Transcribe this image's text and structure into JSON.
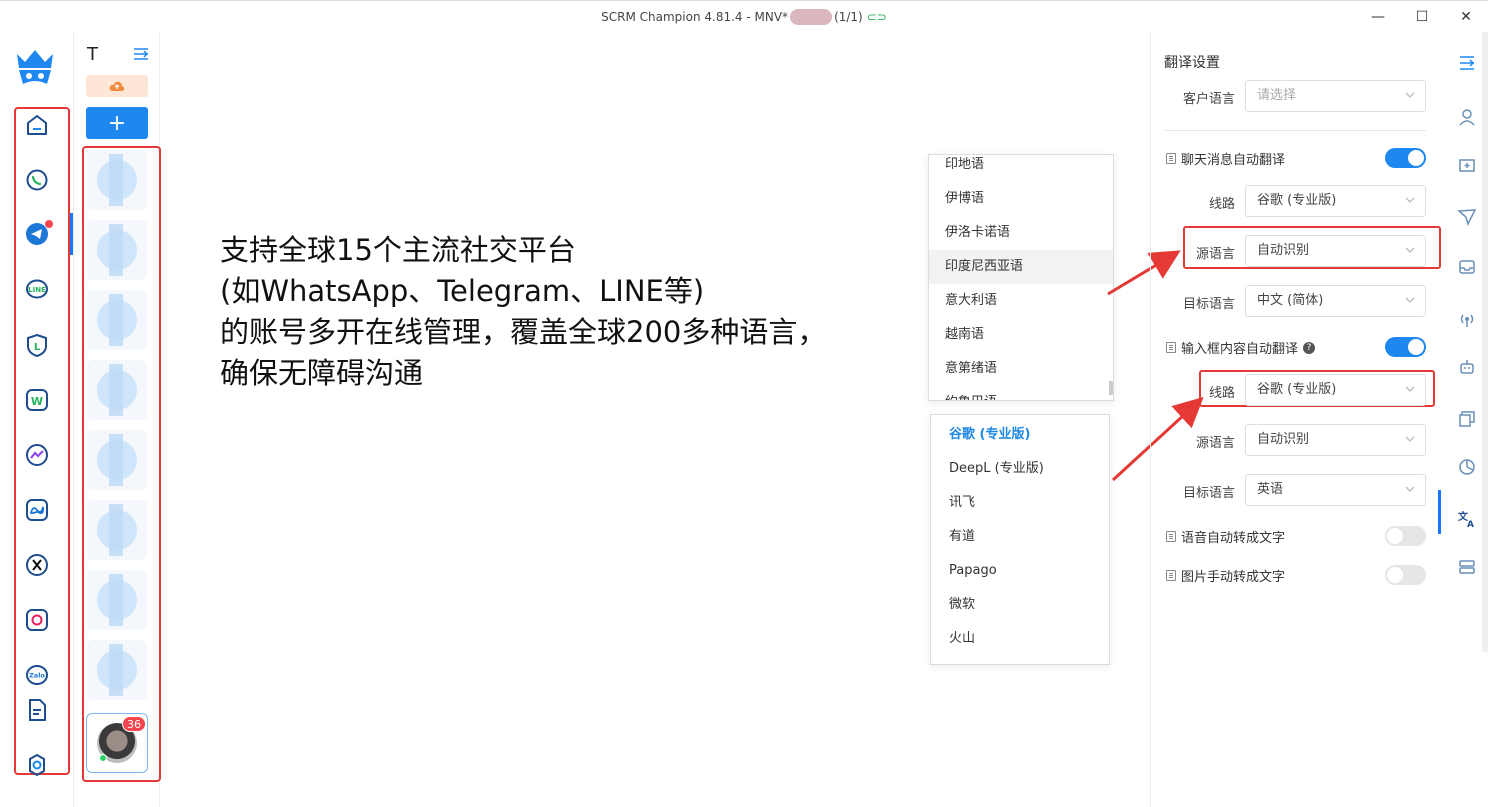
{
  "window": {
    "title_prefix": "SCRM Champion 4.81.4 - MNV*",
    "title_suffix": "(1/1)",
    "minimize_glyph": "—",
    "maximize_glyph": "☐",
    "close_glyph": "✕"
  },
  "left_rail": {
    "items": [
      "home-icon",
      "whatsapp-icon",
      "telegram-icon",
      "line-icon",
      "line-business-icon",
      "whatsapp-business-icon",
      "messenger-icon",
      "meta-icon",
      "x-icon",
      "instagram-icon",
      "zalo-icon",
      "document-icon",
      "settings-icon"
    ],
    "zalo_label": "Zalo",
    "line_label": "LINE",
    "w_label": "W",
    "l_label": "L"
  },
  "accounts": {
    "header_letter": "T",
    "add_glyph": "+",
    "badge_count": "36"
  },
  "promo": {
    "line1": "支持全球15个主流社交平台",
    "line2": "(如WhatsApp、Telegram、LINE等)",
    "line3": "的账号多开在线管理，覆盖全球200多种语言，",
    "line4": "确保无障碍沟通"
  },
  "language_dropdown": {
    "items": [
      "印地语",
      "伊博语",
      "伊洛卡诺语",
      "印度尼西亚语",
      "意大利语",
      "越南语",
      "意第绪语",
      "约鲁巴语"
    ],
    "highlighted": "印度尼西亚语"
  },
  "route_dropdown": {
    "items": [
      "谷歌 (专业版)",
      "DeepL (专业版)",
      "讯飞",
      "有道",
      "Papago",
      "微软",
      "火山"
    ],
    "selected": "谷歌 (专业版)"
  },
  "translate_settings": {
    "title": "翻译设置",
    "customer_language_label": "客户语言",
    "customer_language_placeholder": "请选择",
    "chat_auto_translate_label": "聊天消息自动翻译",
    "chat_auto_translate_on": true,
    "chat_route_label": "线路",
    "chat_route_value": "谷歌 (专业版)",
    "chat_source_label": "源语言",
    "chat_source_value": "自动识别",
    "chat_target_label": "目标语言",
    "chat_target_value": "中文 (简体)",
    "input_auto_translate_label": "输入框内容自动翻译",
    "input_auto_translate_on": true,
    "input_route_label": "线路",
    "input_route_value": "谷歌 (专业版)",
    "input_source_label": "源语言",
    "input_source_value": "自动识别",
    "input_target_label": "目标语言",
    "input_target_value": "英语",
    "voice_to_text_label": "语音自动转成文字",
    "voice_to_text_on": false,
    "image_to_text_label": "图片手动转成文字",
    "image_to_text_on": false
  },
  "right_rail": {
    "items": [
      "collapse-icon",
      "user-icon",
      "add-comment-icon",
      "send-icon",
      "inbox-icon",
      "broadcast-icon",
      "robot-icon",
      "quick-reply-icon",
      "analytics-icon",
      "translate-icon",
      "server-icon"
    ]
  },
  "colors": {
    "accent": "#1e88f0",
    "highlight_red": "#e53935",
    "badge_red": "#f5454f"
  }
}
